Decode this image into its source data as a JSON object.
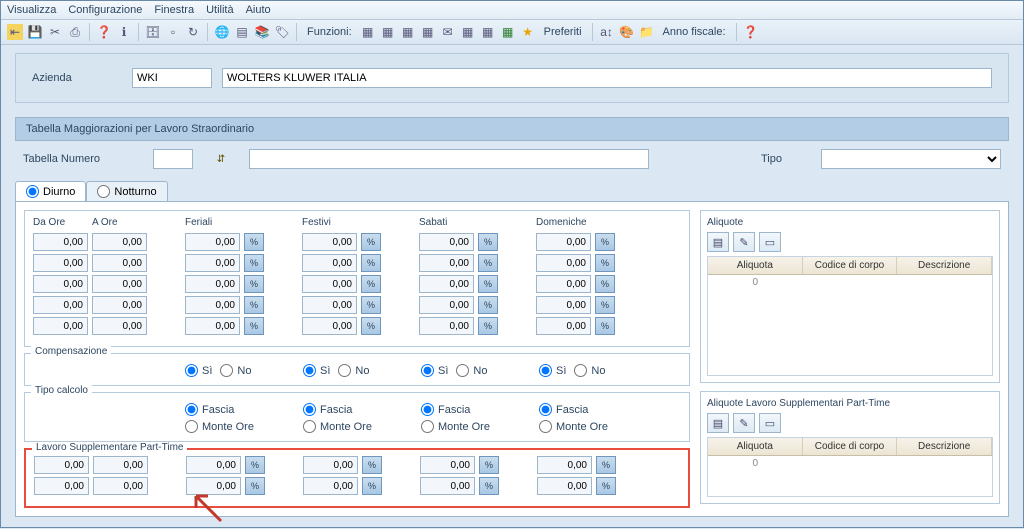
{
  "menu": {
    "items": [
      "Visualizza",
      "Configurazione",
      "Finestra",
      "Utilità",
      "Aiuto"
    ]
  },
  "toolbar": {
    "funzioni": "Funzioni:",
    "preferiti": "Preferiti",
    "anno": "Anno fiscale:"
  },
  "azienda": {
    "label": "Azienda",
    "code": "WKI",
    "name": "WOLTERS KLUWER ITALIA"
  },
  "section_title": "Tabella Maggiorazioni per Lavoro Straordinario",
  "tabella": {
    "num_label": "Tabella Numero",
    "num": "",
    "desc": "",
    "tipo_label": "Tipo",
    "tipo": ""
  },
  "tabs": {
    "diurno": "Diurno",
    "notturno": "Notturno"
  },
  "headers": {
    "daore": "Da Ore",
    "aore": "A Ore",
    "feriali": "Feriali",
    "festivi": "Festivi",
    "sabati": "Sabati",
    "domeniche": "Domeniche"
  },
  "zero": "0,00",
  "compensazione": {
    "label": "Compensazione",
    "si": "Sì",
    "no": "No"
  },
  "tipocalcolo": {
    "label": "Tipo calcolo",
    "fascia": "Fascia",
    "monte": "Monte Ore"
  },
  "lspt": {
    "label": "Lavoro Supplementare Part-Time"
  },
  "aliquote": {
    "title": "Aliquote",
    "c1": "Aliquota",
    "c2": "Codice di corpo",
    "c3": "Descrizione",
    "zero": "0"
  },
  "aliquote_pt": {
    "title": "Aliquote Lavoro Supplementari Part-Time"
  },
  "pct": "%"
}
